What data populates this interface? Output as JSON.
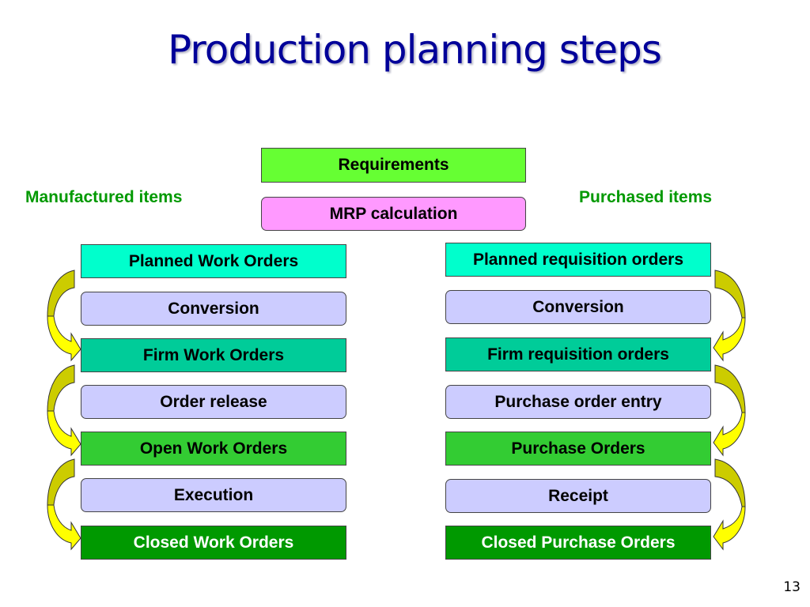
{
  "title": "Production planning steps",
  "top": {
    "requirements": {
      "label": "Requirements",
      "color": "#66ff33"
    },
    "mrp": {
      "label": "MRP calculation",
      "color": "#ff99ff"
    }
  },
  "left": {
    "heading": "Manufactured items",
    "steps": [
      {
        "label": "Planned Work Orders",
        "kind": "state",
        "color": "#00ffcc"
      },
      {
        "label": "Conversion",
        "kind": "action",
        "color": "#ccccff"
      },
      {
        "label": "Firm Work Orders",
        "kind": "state",
        "color": "#00cc99"
      },
      {
        "label": "Order release",
        "kind": "action",
        "color": "#ccccff"
      },
      {
        "label": "Open Work Orders",
        "kind": "state",
        "color": "#33cc33"
      },
      {
        "label": "Execution",
        "kind": "action",
        "color": "#ccccff"
      },
      {
        "label": "Closed Work Orders",
        "kind": "state",
        "color": "#009900"
      }
    ]
  },
  "right": {
    "heading": "Purchased items",
    "steps": [
      {
        "label": "Planned requisition orders",
        "kind": "state",
        "color": "#00ffcc"
      },
      {
        "label": "Conversion",
        "kind": "action",
        "color": "#ccccff"
      },
      {
        "label": "Firm requisition orders",
        "kind": "state",
        "color": "#00cc99"
      },
      {
        "label": "Purchase order entry",
        "kind": "action",
        "color": "#ccccff"
      },
      {
        "label": "Purchase Orders",
        "kind": "state",
        "color": "#33cc33"
      },
      {
        "label": "Receipt",
        "kind": "action",
        "color": "#ccccff"
      },
      {
        "label": "Closed Purchase Orders",
        "kind": "state",
        "color": "#009900"
      }
    ]
  },
  "arrow_colors": {
    "light": "#ffff00",
    "dark": "#cccc00"
  },
  "page_number": "13"
}
